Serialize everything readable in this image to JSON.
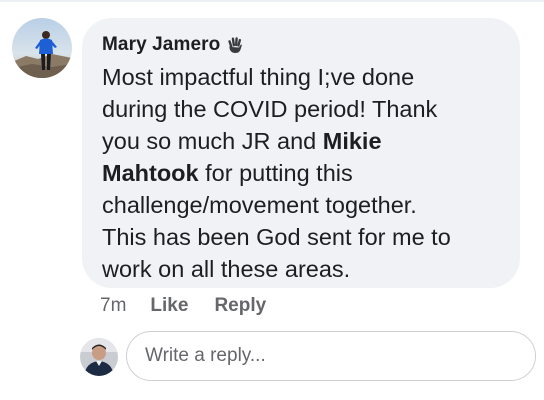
{
  "comment": {
    "author": "Mary Jamero",
    "author_badge_icon": "waving-hand-icon",
    "lines": [
      {
        "pre": "Most impactful thing I;ve done",
        "bold": "",
        "post": ""
      },
      {
        "pre": "during the COVID period! Thank",
        "bold": "",
        "post": ""
      },
      {
        "pre": "you so much JR and ",
        "bold": "Mikie",
        "post": ""
      },
      {
        "pre": "",
        "bold": "Mahtook",
        "post": " for putting this"
      },
      {
        "pre": "challenge/movement together.",
        "bold": "",
        "post": ""
      },
      {
        "pre": "This has been God sent for me to",
        "bold": "",
        "post": ""
      },
      {
        "pre": "work on all these areas.",
        "bold": "",
        "post": ""
      }
    ],
    "time": "7m",
    "like_label": "Like",
    "reply_label": "Reply"
  },
  "reply": {
    "placeholder": "Write a reply...",
    "value": ""
  },
  "colors": {
    "bubble": "#f0f2f5",
    "text": "#1c1e21",
    "secondary": "#65676b",
    "input_border": "#ccd0d5"
  }
}
